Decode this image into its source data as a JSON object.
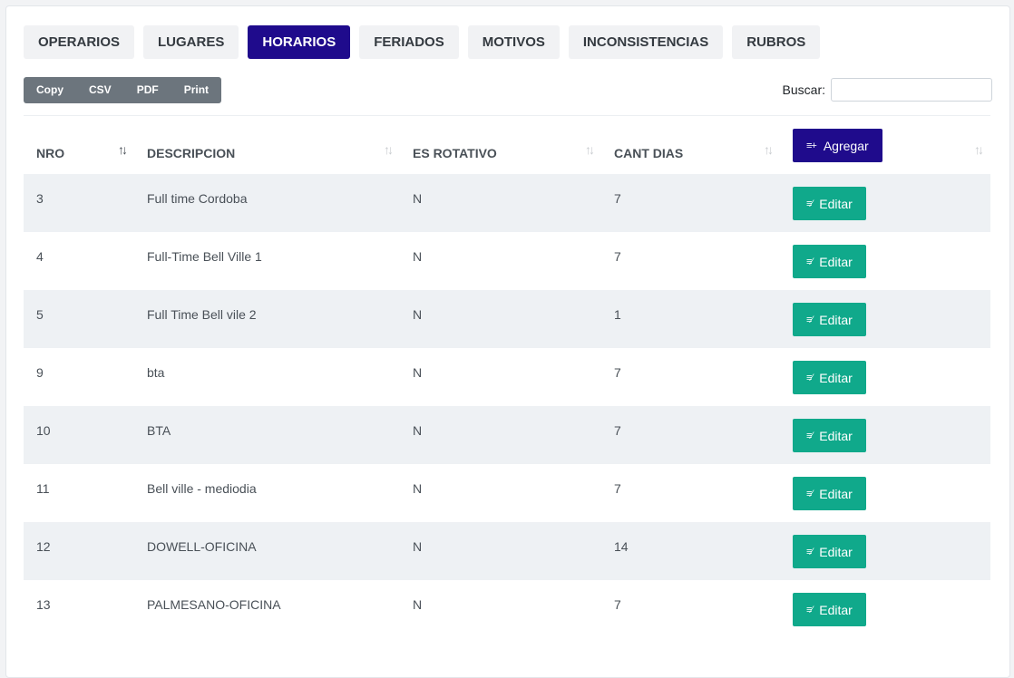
{
  "tabs": [
    "OPERARIOS",
    "LUGARES",
    "HORARIOS",
    "FERIADOS",
    "MOTIVOS",
    "INCONSISTENCIAS",
    "RUBROS"
  ],
  "active_tab": "HORARIOS",
  "export_buttons": {
    "copy": "Copy",
    "csv": "CSV",
    "pdf": "PDF",
    "print": "Print"
  },
  "search": {
    "label": "Buscar:",
    "value": ""
  },
  "table": {
    "headers": {
      "nro": "NRO",
      "descripcion": "DESCRIPCION",
      "es_rotativo": "ES ROTATIVO",
      "cant_dias": "CANT DIAS"
    },
    "add_button": "Agregar",
    "edit_button": "Editar",
    "rows": [
      {
        "nro": "3",
        "descripcion": "Full time Cordoba",
        "es_rotativo": "N",
        "cant_dias": "7"
      },
      {
        "nro": "4",
        "descripcion": "Full-Time Bell Ville 1",
        "es_rotativo": "N",
        "cant_dias": "7"
      },
      {
        "nro": "5",
        "descripcion": "Full Time Bell vile 2",
        "es_rotativo": "N",
        "cant_dias": "1"
      },
      {
        "nro": "9",
        "descripcion": "bta",
        "es_rotativo": "N",
        "cant_dias": "7"
      },
      {
        "nro": "10",
        "descripcion": "BTA",
        "es_rotativo": "N",
        "cant_dias": "7"
      },
      {
        "nro": "11",
        "descripcion": "Bell ville - mediodia",
        "es_rotativo": "N",
        "cant_dias": "7"
      },
      {
        "nro": "12",
        "descripcion": "DOWELL-OFICINA",
        "es_rotativo": "N",
        "cant_dias": "14"
      },
      {
        "nro": "13",
        "descripcion": "PALMESANO-OFICINA",
        "es_rotativo": "N",
        "cant_dias": "7"
      }
    ]
  },
  "colors": {
    "primary": "#1f0b8c",
    "success": "#10a98b",
    "secondary": "#6c757d"
  }
}
